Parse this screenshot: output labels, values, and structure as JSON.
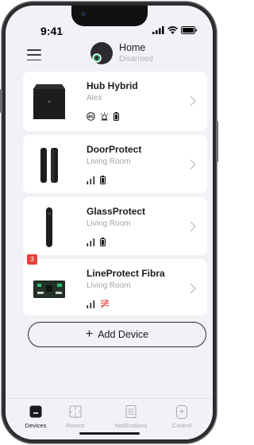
{
  "status_bar": {
    "time": "9:41"
  },
  "header": {
    "hub_name": "Home",
    "hub_state": "Disarmed"
  },
  "devices": [
    {
      "name": "Hub Hybrid",
      "room": "Alex",
      "badge": ""
    },
    {
      "name": "DoorProtect",
      "room": "Living Room",
      "badge": ""
    },
    {
      "name": "GlassProtect",
      "room": "Living Room",
      "badge": ""
    },
    {
      "name": "LineProtect Fibra",
      "room": "Living Room",
      "badge": "3"
    }
  ],
  "add_device_label": "Add Device",
  "tabs": [
    {
      "label": "Devices",
      "icon": "devices-icon",
      "active": true
    },
    {
      "label": "Rooms",
      "icon": "rooms-icon",
      "active": false
    },
    {
      "label": "Notifications",
      "icon": "notifications-icon",
      "active": false
    },
    {
      "label": "Control",
      "icon": "control-icon",
      "active": false
    }
  ],
  "colors": {
    "background": "#f2f1f6",
    "badge": "#e6403a",
    "accent_green": "#2fbf71",
    "warning_red": "#e6403a"
  }
}
